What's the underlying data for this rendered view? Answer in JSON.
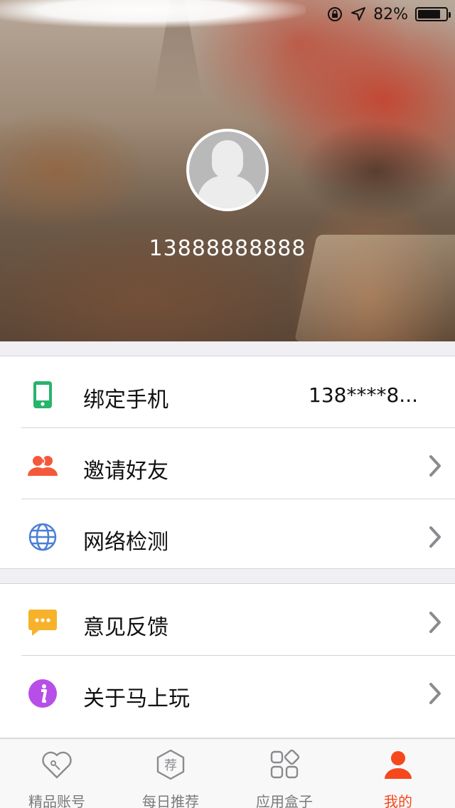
{
  "status_bar": {
    "battery_percent": "82%",
    "battery_level": 0.82,
    "icons": [
      "rotation-lock-icon",
      "location-arrow-icon",
      "battery-icon"
    ]
  },
  "profile": {
    "phone": "13888888888",
    "avatar_icon": "default-avatar-icon"
  },
  "menu": {
    "group1": [
      {
        "label": "绑定手机",
        "value": "138****8...",
        "icon": "mobile-phone-icon",
        "icon_color": "#27b46b"
      },
      {
        "label": "邀请好友",
        "icon": "friends-icon",
        "icon_color": "#f4583a"
      },
      {
        "label": "网络检测",
        "icon": "globe-icon",
        "icon_color": "#4a7fd6"
      }
    ],
    "group2": [
      {
        "label": "意见反馈",
        "icon": "feedback-chat-icon",
        "icon_color": "#f6b22a"
      },
      {
        "label": "关于马上玩",
        "icon": "info-icon",
        "icon_color": "#b84ee8"
      }
    ]
  },
  "tabbar": {
    "tabs": [
      {
        "label": "精品账号",
        "icon": "heart-icon"
      },
      {
        "label": "每日推荐",
        "icon": "recommend-hexagon-icon",
        "glyph": "荐"
      },
      {
        "label": "应用盒子",
        "icon": "app-grid-icon"
      },
      {
        "label": "我的",
        "icon": "user-icon",
        "active": true
      }
    ],
    "active_color": "#f5481d",
    "inactive_color": "#7a7a7a"
  }
}
